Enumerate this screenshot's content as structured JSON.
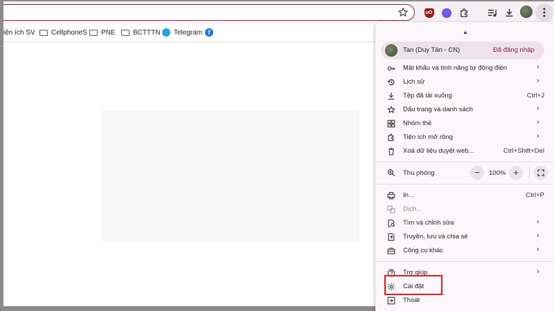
{
  "bookmarks": {
    "items": [
      {
        "label": "iện ích SV",
        "icon": "none"
      },
      {
        "label": "CellphoneS",
        "icon": "folder-icon"
      },
      {
        "label": "PNE",
        "icon": "folder-icon"
      },
      {
        "label": "BCTTTN",
        "icon": "folder-icon"
      },
      {
        "label": "Telegram",
        "icon": "telegram-icon"
      },
      {
        "label": "",
        "icon": "facebook-icon"
      }
    ]
  },
  "toolbar": {
    "extension_icons": [
      "ublock-icon",
      "discord-icon",
      "puzzle-icon",
      "media-control-icon",
      "download-icon",
      "avatar"
    ]
  },
  "menu": {
    "profile": {
      "name": "Tan (Duy Tân - CN)",
      "status": "Đã đăng nhập"
    },
    "group1": [
      {
        "label": "Mật khẩu và tính năng tự động điền",
        "shortcut": "",
        "submenu": true,
        "icon": "key-icon"
      },
      {
        "label": "Lịch sử",
        "shortcut": "",
        "submenu": true,
        "icon": "history-icon"
      },
      {
        "label": "Tệp đã tải xuống",
        "shortcut": "Ctrl+J",
        "submenu": false,
        "icon": "download-icon"
      },
      {
        "label": "Dấu trang và danh sách",
        "shortcut": "",
        "submenu": true,
        "icon": "star-icon"
      },
      {
        "label": "Nhóm thẻ",
        "shortcut": "",
        "submenu": true,
        "icon": "tab-groups-icon"
      },
      {
        "label": "Tiện ích mở rộng",
        "shortcut": "",
        "submenu": true,
        "icon": "puzzle-icon"
      },
      {
        "label": "Xoá dữ liệu duyệt web...",
        "shortcut": "Ctrl+Shift+Del",
        "submenu": false,
        "icon": "trash-icon"
      }
    ],
    "zoom": {
      "label": "Thu phóng",
      "minus": "−",
      "value": "100%",
      "plus": "+"
    },
    "group2": [
      {
        "label": "In...",
        "shortcut": "Ctrl+P",
        "submenu": false,
        "icon": "print-icon"
      },
      {
        "label": "Dịch...",
        "shortcut": "",
        "submenu": false,
        "icon": "translate-icon",
        "disabled": true
      },
      {
        "label": "Tìm và chỉnh sửa",
        "shortcut": "",
        "submenu": true,
        "icon": "find-icon"
      },
      {
        "label": "Truyền, lưu và chia sẻ",
        "shortcut": "",
        "submenu": true,
        "icon": "cast-icon"
      },
      {
        "label": "Công cụ khác",
        "shortcut": "",
        "submenu": true,
        "icon": "toolbox-icon"
      }
    ],
    "group3": [
      {
        "label": "Trợ giúp",
        "shortcut": "",
        "submenu": true,
        "icon": "help-icon"
      },
      {
        "label": "Cài đặt",
        "shortcut": "",
        "submenu": false,
        "icon": "gear-icon",
        "highlighted": true
      },
      {
        "label": "Thoát",
        "shortcut": "",
        "submenu": false,
        "icon": "exit-icon"
      }
    ],
    "highlight_color": "#e0191b",
    "accent_color": "#8a1c3f"
  }
}
